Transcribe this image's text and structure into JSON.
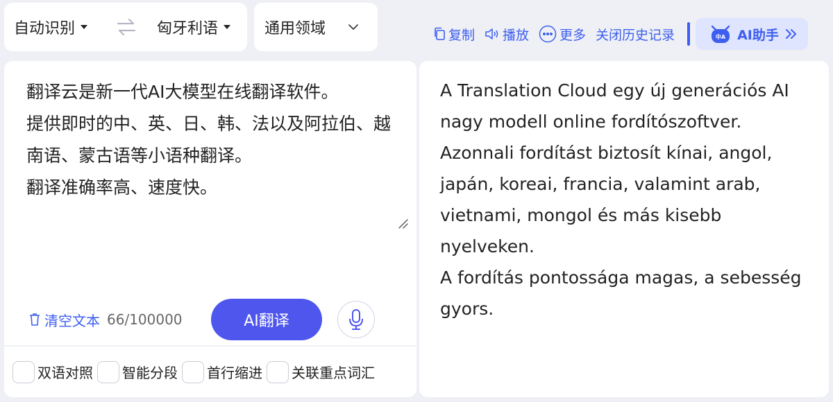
{
  "language_bar": {
    "source_lang": "自动识别",
    "target_lang": "匈牙利语",
    "domain": "通用领域"
  },
  "toolbar": {
    "copy": "复制",
    "play": "播放",
    "more": "更多",
    "close_history": "关闭历史记录",
    "ai_assistant": "AI助手",
    "ai_badge_text": "中A"
  },
  "source": {
    "text": "翻译云是新一代AI大模型在线翻译软件。\n提供即时的中、英、日、韩、法以及阿拉伯、越南语、蒙古语等小语种翻译。\n翻译准确率高、速度快。",
    "clear_label": "清空文本",
    "counter": "66/100000",
    "translate_label": "AI翻译"
  },
  "options": [
    {
      "label": "双语对照"
    },
    {
      "label": "智能分段"
    },
    {
      "label": "首行缩进"
    },
    {
      "label": "关联重点词汇"
    }
  ],
  "target": {
    "text": "A Translation Cloud egy új generációs AI nagy modell online fordítószoftver.\nAzonnali fordítást biztosít kínai, angol, japán, koreai, francia, valamint arab, vietnami, mongol és más kisebb nyelveken.\nA fordítás pontossága magas, a sebesség gyors."
  },
  "colors": {
    "accent": "#3d5ef0",
    "button": "#4e56ee",
    "background": "#eef0f5"
  }
}
